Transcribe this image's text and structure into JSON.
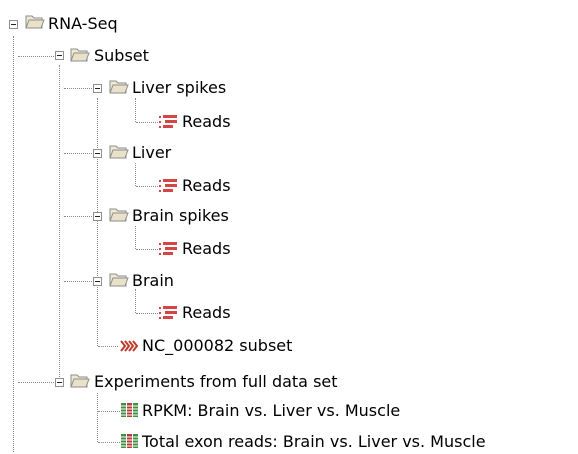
{
  "tree": {
    "root": {
      "label": "RNA-Seq",
      "children": {
        "subset": {
          "label": "Subset",
          "liver_spikes": {
            "label": "Liver spikes",
            "reads": "Reads"
          },
          "liver": {
            "label": "Liver",
            "reads": "Reads"
          },
          "brain_spikes": {
            "label": "Brain spikes",
            "reads": "Reads"
          },
          "brain": {
            "label": "Brain",
            "reads": "Reads"
          },
          "nc_subset": "NC_000082 subset"
        },
        "experiments": {
          "label": "Experiments from full data set",
          "rpkm": "RPKM: Brain vs. Liver vs. Muscle",
          "total_exon": "Total exon reads: Brain vs. Liver vs. Muscle"
        }
      }
    }
  },
  "icons": {
    "folder": "folder-open-icon",
    "reads": "reads-sequence-icon",
    "track": "track-icon",
    "experiment": "experiment-table-icon"
  },
  "colors": {
    "folder": "#d9d2b6",
    "reads": "#d64545",
    "track": "#c0392b",
    "experiment_green": "#3f8f3f",
    "experiment_red": "#b73b3b",
    "connector": "#8a8a8a"
  }
}
